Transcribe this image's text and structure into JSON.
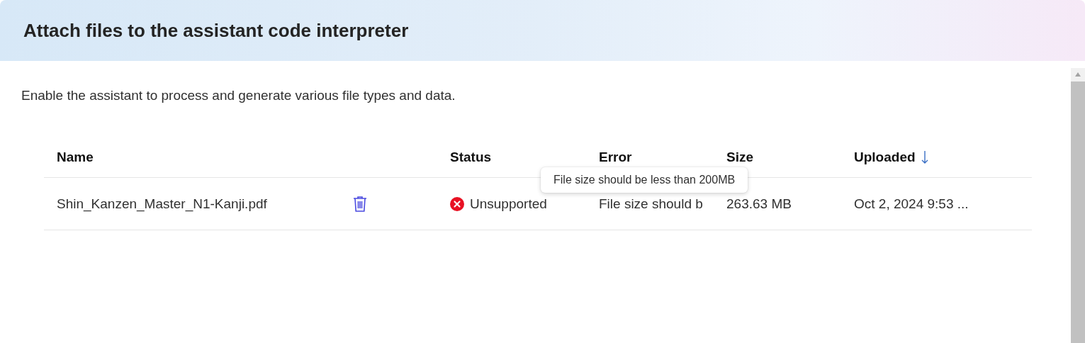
{
  "dialog": {
    "title": "Attach files to the assistant code interpreter",
    "description": "Enable the assistant to process and generate various file types and data."
  },
  "table": {
    "columns": [
      {
        "label": "Name"
      },
      {},
      {
        "label": "Status"
      },
      {
        "label": "Error"
      },
      {
        "label": "Size"
      },
      {
        "label": "Uploaded",
        "sorted": true
      }
    ],
    "rows": [
      {
        "name": "Shin_Kanzen_Master_N1-Kanji.pdf",
        "status": {
          "kind": "error",
          "label": "Unsupported"
        },
        "error": "File size should b",
        "size": "263.63 MB",
        "uploaded": "Oct 2, 2024 9:53 ..."
      }
    ]
  },
  "tooltip": {
    "text": "File size should be less than 200MB"
  }
}
